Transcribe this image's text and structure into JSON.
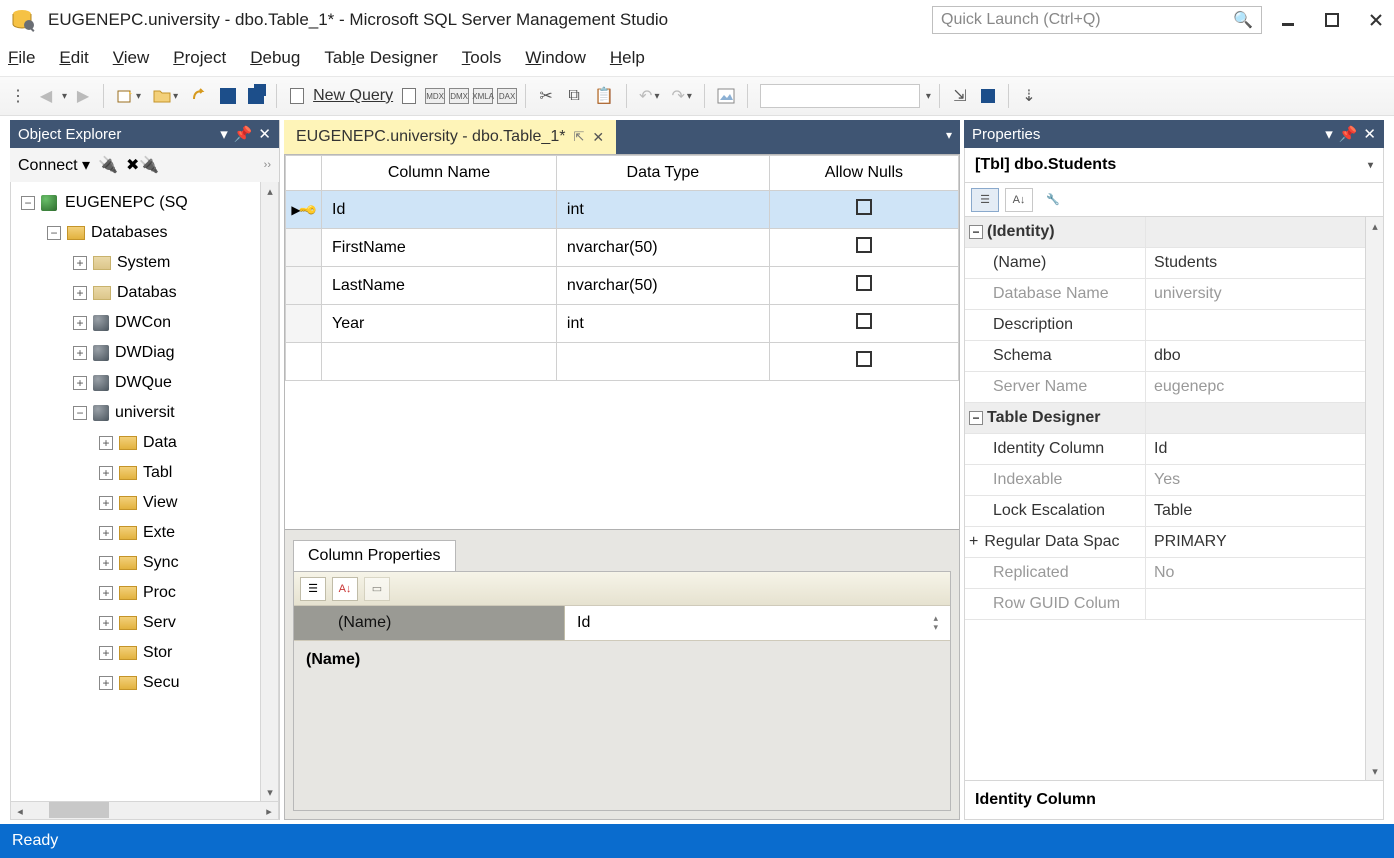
{
  "window": {
    "title": "EUGENEPC.university - dbo.Table_1* - Microsoft SQL Server Management Studio",
    "quicklaunch_placeholder": "Quick Launch (Ctrl+Q)"
  },
  "menu": {
    "file": "File",
    "edit": "Edit",
    "view": "View",
    "project": "Project",
    "debug": "Debug",
    "table_designer": "Table Designer",
    "tools": "Tools",
    "window": "Window",
    "help": "Help"
  },
  "toolbar": {
    "new_query": "New Query",
    "badges": {
      "mdx": "MDX",
      "dmx": "DMX",
      "xmla": "XMLA",
      "dax": "DAX"
    }
  },
  "objexplorer": {
    "title": "Object Explorer",
    "connect": "Connect",
    "root": "EUGENEPC (SQ",
    "databases": "Databases",
    "items": [
      {
        "label": "System",
        "icon": "folder-dim"
      },
      {
        "label": "Databas",
        "icon": "folder-dim"
      },
      {
        "label": "DWCon",
        "icon": "db"
      },
      {
        "label": "DWDiag",
        "icon": "db"
      },
      {
        "label": "DWQue",
        "icon": "db"
      },
      {
        "label": "universit",
        "icon": "db",
        "expanded": true
      }
    ],
    "uni_children": [
      "Data",
      "Tabl",
      "View",
      "Exte",
      "Sync",
      "Proc",
      "Serv",
      "Stor",
      "Secu"
    ]
  },
  "tab": {
    "label": "EUGENEPC.university - dbo.Table_1*"
  },
  "columns": {
    "headers": {
      "name": "Column Name",
      "type": "Data Type",
      "nulls": "Allow Nulls"
    },
    "rows": [
      {
        "name": "Id",
        "type": "int",
        "pk": true,
        "selected": true
      },
      {
        "name": "FirstName",
        "type": "nvarchar(50)"
      },
      {
        "name": "LastName",
        "type": "nvarchar(50)"
      },
      {
        "name": "Year",
        "type": "int"
      }
    ]
  },
  "colprops": {
    "tab": "Column Properties",
    "name_label": "(Name)",
    "name_value": "Id",
    "detail": "(Name)"
  },
  "properties": {
    "title": "Properties",
    "object": "[Tbl] dbo.Students",
    "cat_identity": "(Identity)",
    "name_lbl": "(Name)",
    "name_val": "Students",
    "dbname_lbl": "Database Name",
    "dbname_val": "university",
    "desc_lbl": "Description",
    "desc_val": "",
    "schema_lbl": "Schema",
    "schema_val": "dbo",
    "server_lbl": "Server Name",
    "server_val": "eugenepc",
    "cat_td": "Table Designer",
    "idcol_lbl": "Identity Column",
    "idcol_val": "Id",
    "index_lbl": "Indexable",
    "index_val": "Yes",
    "lock_lbl": "Lock Escalation",
    "lock_val": "Table",
    "rds_lbl": "Regular Data Spac",
    "rds_val": "PRIMARY",
    "repl_lbl": "Replicated",
    "repl_val": "No",
    "rguid_lbl": "Row GUID Colum",
    "rguid_val": "",
    "selected": "Identity Column"
  },
  "status": {
    "text": "Ready"
  }
}
